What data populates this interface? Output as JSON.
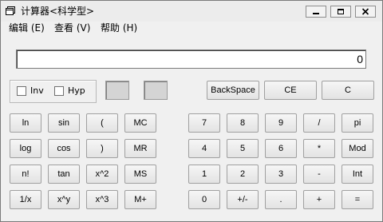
{
  "window": {
    "title": "计算器<科学型>",
    "icon": "calculator-app-icon"
  },
  "menu": [
    {
      "label": "编辑 (E)"
    },
    {
      "label": "查看 (V)"
    },
    {
      "label": "帮助 (H)"
    }
  ],
  "display": {
    "value": "0"
  },
  "options": {
    "inv_label": "Inv",
    "inv_checked": false,
    "hyp_label": "Hyp",
    "hyp_checked": false
  },
  "top_buttons": [
    {
      "label": "BackSpace"
    },
    {
      "label": "CE"
    },
    {
      "label": "C"
    }
  ],
  "sci_buttons": [
    [
      "ln",
      "sin",
      "(",
      "MC"
    ],
    [
      "log",
      "cos",
      ")",
      "MR"
    ],
    [
      "n!",
      "tan",
      "x^2",
      "MS"
    ],
    [
      "1/x",
      "x^y",
      "x^3",
      "M+"
    ]
  ],
  "num_buttons": [
    [
      "7",
      "8",
      "9",
      "/",
      "pi"
    ],
    [
      "4",
      "5",
      "6",
      "*",
      "Mod"
    ],
    [
      "1",
      "2",
      "3",
      "-",
      "Int"
    ],
    [
      "0",
      "+/-",
      ".",
      "+",
      "="
    ]
  ]
}
